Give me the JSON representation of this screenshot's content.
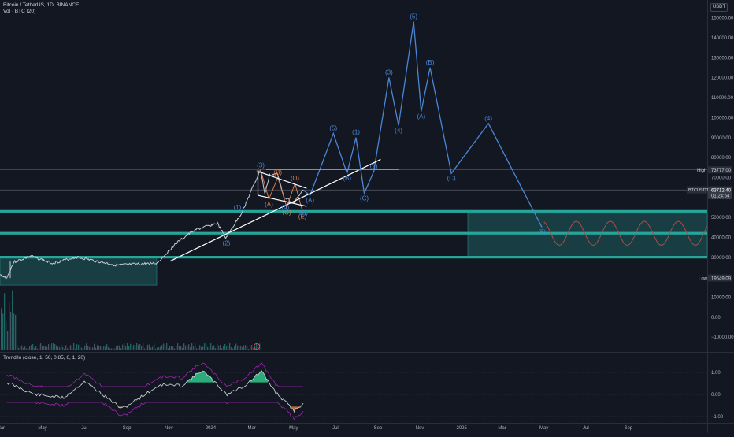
{
  "header": {
    "symbol_line": "Bitcoin / TetherUS, 1D, BINANCE",
    "volume_line": "Vol · BTC (20)"
  },
  "currency": "USDT",
  "indicator": {
    "title": "Trendilo (close, 1, 50, 0.85, 6, 1, 20)"
  },
  "price_axis": {
    "ticks": [
      "150000.00",
      "140000.00",
      "130000.00",
      "120000.00",
      "110000.00",
      "100000.00",
      "90000.00",
      "80000.00",
      "70000.00",
      "60000.00",
      "50000.00",
      "40000.00",
      "30000.00",
      "20000.00",
      "10000.00",
      "0.00",
      "−10000.00"
    ],
    "high_label": "High",
    "high_value": "73777.00",
    "low_label": "Low",
    "low_value": "19549.09",
    "current_symbol": "BTCUSDT",
    "current_price": "63712.40",
    "countdown": "01:24:54"
  },
  "indicator_axis": {
    "ticks": [
      "1.00",
      "0.00",
      "−1.00"
    ]
  },
  "time_axis": {
    "ticks": [
      "Mar",
      "May",
      "Jul",
      "Sep",
      "Nov",
      "2024",
      "Mar",
      "May",
      "Jul",
      "Sep",
      "Nov",
      "2025",
      "Mar",
      "May",
      "Jul",
      "Sep"
    ]
  },
  "colors": {
    "background": "#131722",
    "wave_blue": "#4a86d4",
    "wave_orange": "#d07a4a",
    "zone_teal": "#26a69a",
    "trendline": "#ffffff",
    "candle": "#c5cbd3"
  },
  "chart_data": {
    "type": "line",
    "y_axis_scale": "linear",
    "y_range": [
      -13000,
      157000
    ],
    "key_levels": [
      73777,
      53000,
      42000,
      30000
    ],
    "support_zones": [
      {
        "from": 16000,
        "to": 30500
      },
      {
        "from": 30000,
        "to": 52000
      }
    ],
    "price_path_main": [
      {
        "x": "2023-02-28",
        "y": 21000
      },
      {
        "x": "2023-03-10",
        "y": 19600
      },
      {
        "x": "2023-03-20",
        "y": 27500
      },
      {
        "x": "2023-04-14",
        "y": 30500
      },
      {
        "x": "2023-05-15",
        "y": 27000
      },
      {
        "x": "2023-06-20",
        "y": 30000
      },
      {
        "x": "2023-08-17",
        "y": 26000
      },
      {
        "x": "2023-10-15",
        "y": 27000
      },
      {
        "x": "2023-11-10",
        "y": 36500
      },
      {
        "x": "2023-12-08",
        "y": 43500
      },
      {
        "x": "2024-01-11",
        "y": 47000
      },
      {
        "x": "2024-01-23",
        "y": 39500
      },
      {
        "x": "2024-02-15",
        "y": 52000
      },
      {
        "x": "2024-03-05",
        "y": 67000
      },
      {
        "x": "2024-03-14",
        "y": 73777
      },
      {
        "x": "2024-03-20",
        "y": 61500
      },
      {
        "x": "2024-03-27",
        "y": 71000
      },
      {
        "x": "2024-04-07",
        "y": 72000
      },
      {
        "x": "2024-04-17",
        "y": 60500
      },
      {
        "x": "2024-05-01",
        "y": 57000
      },
      {
        "x": "2024-05-15",
        "y": 63712
      }
    ],
    "wave_projection_blue": [
      {
        "x": "2024-05-25",
        "y": 61000,
        "label": "(A)"
      },
      {
        "x": "2024-06-28",
        "y": 92000,
        "label": "(5)"
      },
      {
        "x": "2024-07-18",
        "y": 72000,
        "label": "(B)"
      },
      {
        "x": "2024-07-31",
        "y": 90000,
        "label": "(1)"
      },
      {
        "x": "2024-08-12",
        "y": 62000,
        "label": "(C)"
      },
      {
        "x": "2024-08-26",
        "y": 73000,
        "label": "(2)"
      },
      {
        "x": "2024-09-17",
        "y": 120000,
        "label": "(3)"
      },
      {
        "x": "2024-10-01",
        "y": 96000,
        "label": "(4)"
      },
      {
        "x": "2024-10-23",
        "y": 148000,
        "label": "(5)"
      },
      {
        "x": "2024-11-03",
        "y": 103000,
        "label": "(A)"
      },
      {
        "x": "2024-11-16",
        "y": 125000,
        "label": "(B)"
      },
      {
        "x": "2024-12-17",
        "y": 72000,
        "label": "(C)"
      },
      {
        "x": "2025-02-09",
        "y": 97000,
        "label": "(4)"
      },
      {
        "x": "2025-04-28",
        "y": 45000,
        "label": "(5)"
      }
    ],
    "wave_projection_orange": [
      {
        "x": "2024-03-26",
        "y": 59000,
        "label": "(A)"
      },
      {
        "x": "2024-04-08",
        "y": 70000,
        "label": "(B)"
      },
      {
        "x": "2024-04-21",
        "y": 55000,
        "label": "(C)"
      },
      {
        "x": "2024-05-03",
        "y": 67000,
        "label": "(D)"
      },
      {
        "x": "2024-05-14",
        "y": 53000,
        "label": "(E)"
      }
    ],
    "wave_labels_blue_other": [
      {
        "x": "2024-02-09",
        "y": 54000,
        "label": "(1)"
      },
      {
        "x": "2024-01-24",
        "y": 36000,
        "label": "(2)"
      },
      {
        "x": "2024-03-14",
        "y": 75000,
        "label": "(3)"
      },
      {
        "x": "2024-04-19",
        "y": 54000,
        "label": "(4)"
      },
      {
        "x": "2024-05-16",
        "y": 51000,
        "label": "(5)"
      }
    ],
    "projection_cycle": {
      "start": "2025-05-01",
      "end": "2025-12-25",
      "center": 42000,
      "amplitude": 6000,
      "cycles": 4.8
    },
    "volume_bars_present": true,
    "indicator_values": [
      {
        "x": "2023-03-10",
        "y": 0.55
      },
      {
        "x": "2023-04-20",
        "y": 0.0
      },
      {
        "x": "2023-06-01",
        "y": -0.15
      },
      {
        "x": "2023-07-01",
        "y": 0.6
      },
      {
        "x": "2023-08-01",
        "y": -0.1
      },
      {
        "x": "2023-08-25",
        "y": -0.65
      },
      {
        "x": "2023-10-20",
        "y": 0.45
      },
      {
        "x": "2023-11-20",
        "y": 0.4
      },
      {
        "x": "2023-12-20",
        "y": 1.1
      },
      {
        "x": "2024-01-25",
        "y": 0.0
      },
      {
        "x": "2024-02-20",
        "y": 0.4
      },
      {
        "x": "2024-03-15",
        "y": 1.05
      },
      {
        "x": "2024-04-05",
        "y": 0.1
      },
      {
        "x": "2024-05-02",
        "y": -0.75
      },
      {
        "x": "2024-05-15",
        "y": -0.4
      }
    ]
  }
}
